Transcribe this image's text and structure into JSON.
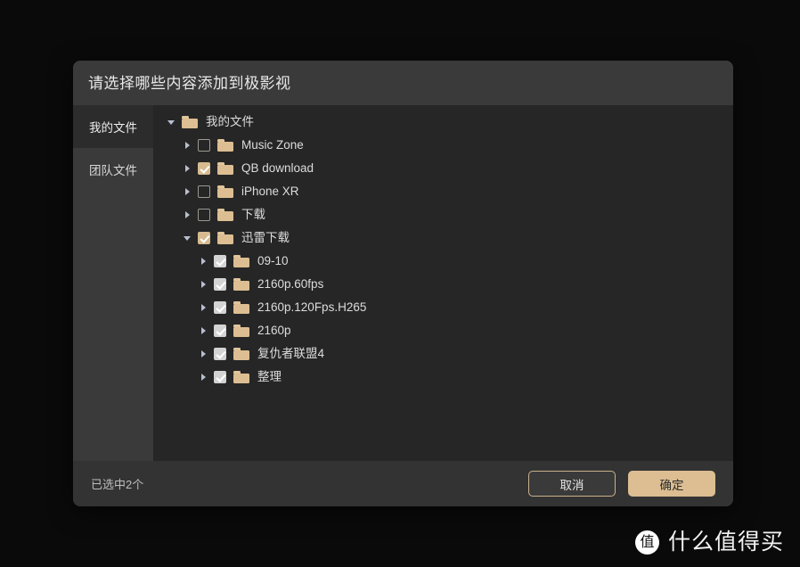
{
  "dialog": {
    "title": "请选择哪些内容添加到极影视"
  },
  "sidebar": {
    "items": [
      {
        "label": "我的文件",
        "active": true
      },
      {
        "label": "团队文件",
        "active": false
      }
    ]
  },
  "tree": {
    "nodes": [
      {
        "label": "我的文件",
        "depth": 0,
        "caret": "expanded",
        "checkbox": "none",
        "folder": true
      },
      {
        "label": "Music Zone",
        "depth": 1,
        "caret": "collapsed",
        "checkbox": "unchecked",
        "folder": true
      },
      {
        "label": "QB download",
        "depth": 1,
        "caret": "collapsed",
        "checkbox": "checked-tan",
        "folder": true
      },
      {
        "label": "iPhone XR",
        "depth": 1,
        "caret": "collapsed",
        "checkbox": "unchecked",
        "folder": true
      },
      {
        "label": "下载",
        "depth": 1,
        "caret": "collapsed",
        "checkbox": "unchecked",
        "folder": true
      },
      {
        "label": "迅雷下载",
        "depth": 1,
        "caret": "expanded",
        "checkbox": "checked-tan",
        "folder": true
      },
      {
        "label": "09-10",
        "depth": 2,
        "caret": "collapsed",
        "checkbox": "checked-gray",
        "folder": true
      },
      {
        "label": "2160p.60fps",
        "depth": 2,
        "caret": "collapsed",
        "checkbox": "checked-gray",
        "folder": true
      },
      {
        "label": "2160p.120Fps.H265",
        "depth": 2,
        "caret": "collapsed",
        "checkbox": "checked-gray",
        "folder": true
      },
      {
        "label": "2160p",
        "depth": 2,
        "caret": "collapsed",
        "checkbox": "checked-gray",
        "folder": true
      },
      {
        "label": "复仇者联盟4",
        "depth": 2,
        "caret": "collapsed",
        "checkbox": "checked-gray",
        "folder": true
      },
      {
        "label": "整理",
        "depth": 2,
        "caret": "collapsed",
        "checkbox": "checked-gray",
        "folder": true
      }
    ]
  },
  "footer": {
    "selected_count_label": "已选中2个",
    "cancel_label": "取消",
    "confirm_label": "确定"
  },
  "watermark": {
    "logo_glyph": "值",
    "text": "什么值得买"
  },
  "colors": {
    "page_background": "#0a0a0a",
    "dialog_background": "#262626",
    "header_background": "#3a3a3a",
    "sidebar_background": "#3a3a3a",
    "footer_background": "#333333",
    "accent_tan": "#dcbe92",
    "folder_tan": "#dcbe92",
    "text_primary": "#e8e8e8",
    "text_secondary": "#bdbdbd"
  }
}
